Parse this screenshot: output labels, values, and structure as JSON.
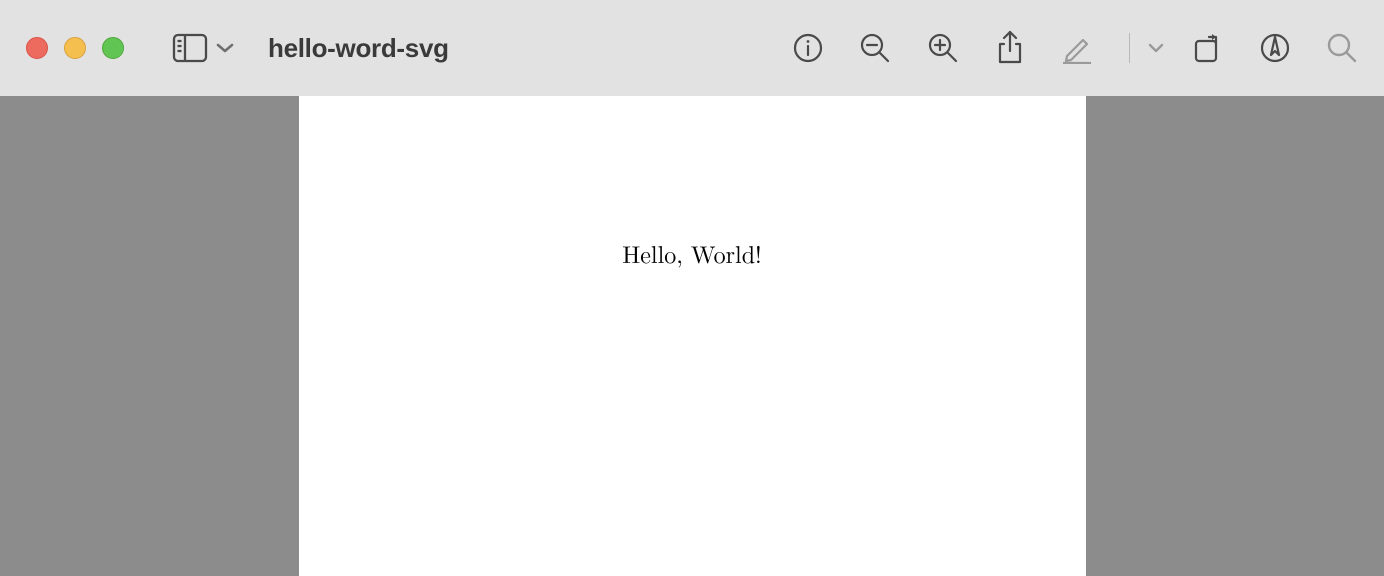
{
  "window": {
    "title": "hello-word-svg"
  },
  "document": {
    "body_text": "Hello, World!"
  }
}
